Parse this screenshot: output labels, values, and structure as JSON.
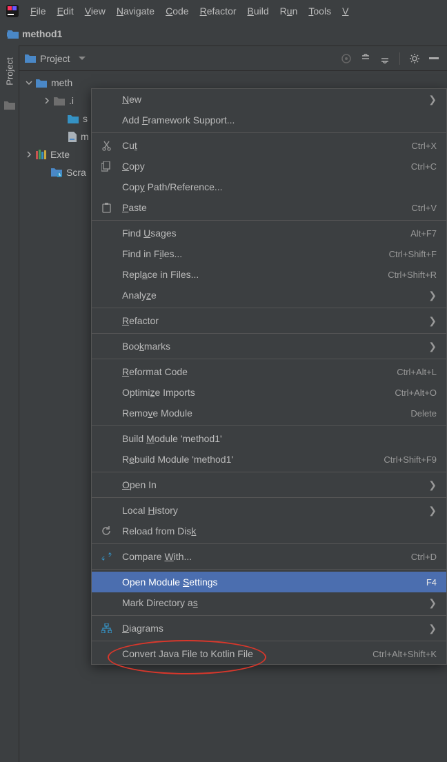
{
  "menubar": {
    "items": [
      {
        "pre": "",
        "ul": "F",
        "post": "ile"
      },
      {
        "pre": "",
        "ul": "E",
        "post": "dit"
      },
      {
        "pre": "",
        "ul": "V",
        "post": "iew"
      },
      {
        "pre": "",
        "ul": "N",
        "post": "avigate"
      },
      {
        "pre": "",
        "ul": "C",
        "post": "ode"
      },
      {
        "pre": "",
        "ul": "R",
        "post": "efactor"
      },
      {
        "pre": "",
        "ul": "B",
        "post": "uild"
      },
      {
        "pre": "R",
        "ul": "u",
        "post": "n"
      },
      {
        "pre": "",
        "ul": "T",
        "post": "ools"
      },
      {
        "pre": "",
        "ul": "V",
        "post": ""
      }
    ]
  },
  "breadcrumb": {
    "label": "method1"
  },
  "gutter": {
    "label": "Project"
  },
  "project_header": {
    "label": "Project"
  },
  "tree": {
    "rows": [
      {
        "label": "meth",
        "icon": "module",
        "expander": "down"
      },
      {
        "label": ".i",
        "icon": "folder-dark",
        "expander": "right"
      },
      {
        "label": "s",
        "icon": "folder-blue",
        "expander": ""
      },
      {
        "label": "m",
        "icon": "file",
        "expander": ""
      },
      {
        "label": "Exte",
        "icon": "library",
        "expander": "right"
      },
      {
        "label": "Scra",
        "icon": "scratch",
        "expander": ""
      }
    ]
  },
  "context_menu": {
    "groups": [
      [
        {
          "label": {
            "pre": "",
            "ul": "N",
            "post": "ew"
          },
          "arrow": true
        },
        {
          "label": {
            "pre": "Add ",
            "ul": "F",
            "post": "ramework Support..."
          }
        }
      ],
      [
        {
          "icon": "cut",
          "label": {
            "pre": "Cu",
            "ul": "t",
            "post": ""
          },
          "shortcut": "Ctrl+X"
        },
        {
          "icon": "copy",
          "label": {
            "pre": "",
            "ul": "C",
            "post": "opy"
          },
          "shortcut": "Ctrl+C"
        },
        {
          "label": {
            "pre": "Cop",
            "ul": "y",
            "post": " Path/Reference..."
          }
        },
        {
          "icon": "paste",
          "label": {
            "pre": "",
            "ul": "P",
            "post": "aste"
          },
          "shortcut": "Ctrl+V"
        }
      ],
      [
        {
          "label": {
            "pre": "Find ",
            "ul": "U",
            "post": "sages"
          },
          "shortcut": "Alt+F7"
        },
        {
          "label": {
            "pre": "Find in F",
            "ul": "i",
            "post": "les..."
          },
          "shortcut": "Ctrl+Shift+F"
        },
        {
          "label": {
            "pre": "Repl",
            "ul": "a",
            "post": "ce in Files..."
          },
          "shortcut": "Ctrl+Shift+R"
        },
        {
          "label": {
            "pre": "Analy",
            "ul": "z",
            "post": "e"
          },
          "arrow": true
        }
      ],
      [
        {
          "label": {
            "pre": "",
            "ul": "R",
            "post": "efactor"
          },
          "arrow": true
        }
      ],
      [
        {
          "label": {
            "pre": "Boo",
            "ul": "k",
            "post": "marks"
          },
          "arrow": true
        }
      ],
      [
        {
          "label": {
            "pre": "",
            "ul": "R",
            "post": "eformat Code"
          },
          "shortcut": "Ctrl+Alt+L"
        },
        {
          "label": {
            "pre": "Optimi",
            "ul": "z",
            "post": "e Imports"
          },
          "shortcut": "Ctrl+Alt+O"
        },
        {
          "label": {
            "pre": "Remo",
            "ul": "v",
            "post": "e Module"
          },
          "shortcut": "Delete"
        }
      ],
      [
        {
          "label": {
            "pre": "Build ",
            "ul": "M",
            "post": "odule 'method1'"
          }
        },
        {
          "label": {
            "pre": "R",
            "ul": "e",
            "post": "build Module 'method1'"
          },
          "shortcut": "Ctrl+Shift+F9"
        }
      ],
      [
        {
          "label": {
            "pre": "",
            "ul": "O",
            "post": "pen In"
          },
          "arrow": true
        }
      ],
      [
        {
          "label": {
            "pre": "Local ",
            "ul": "H",
            "post": "istory"
          },
          "arrow": true
        },
        {
          "icon": "reload",
          "label": {
            "pre": "Reload from Dis",
            "ul": "k",
            "post": ""
          }
        }
      ],
      [
        {
          "icon": "compare",
          "label": {
            "pre": "Compare ",
            "ul": "W",
            "post": "ith..."
          },
          "shortcut": "Ctrl+D"
        }
      ],
      [
        {
          "label": {
            "pre": "Open Module ",
            "ul": "S",
            "post": "ettings"
          },
          "shortcut": "F4",
          "highlight": true
        },
        {
          "label": {
            "pre": "Mark Directory a",
            "ul": "s",
            "post": ""
          },
          "arrow": true
        }
      ],
      [
        {
          "icon": "diagram",
          "label": {
            "pre": "",
            "ul": "D",
            "post": "iagrams"
          },
          "arrow": true
        }
      ],
      [
        {
          "label": {
            "pre": "Convert Java File to Kotlin File",
            "ul": "",
            "post": ""
          },
          "shortcut": "Ctrl+Alt+Shift+K"
        }
      ]
    ]
  }
}
